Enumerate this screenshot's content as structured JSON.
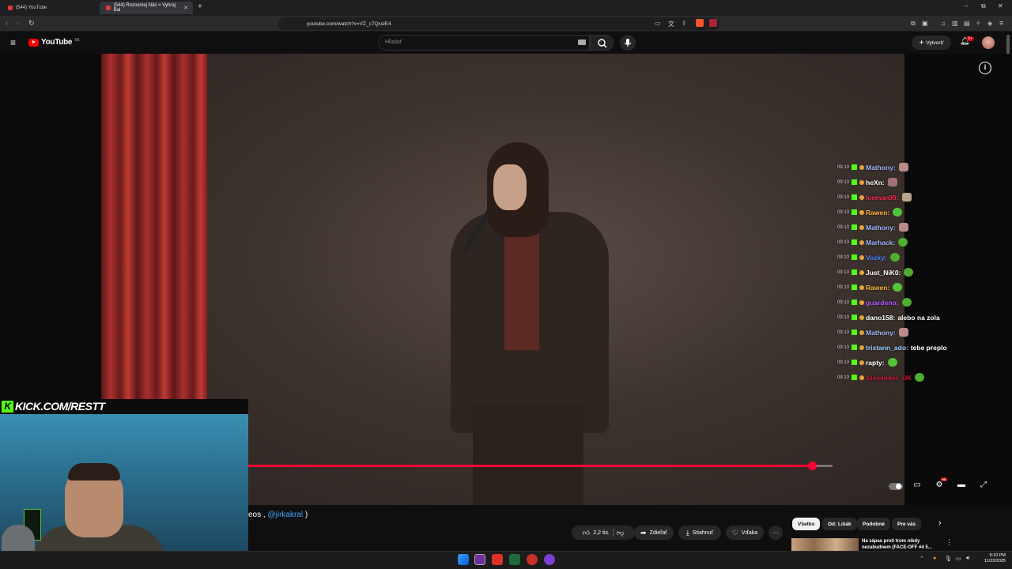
{
  "browser": {
    "tabs": [
      {
        "title": "(544) YouTube"
      },
      {
        "title": "(544) Rozosmej Nás = Vyhraj Bal"
      }
    ],
    "new_tab_symbol": "+",
    "url": "youtube.com/watch?v=VZ_c7QxsIE4",
    "window_controls": {
      "minimize": "–",
      "restore": "⧉",
      "close": "✕"
    },
    "toolbar_icons": [
      "back-icon",
      "forward-icon",
      "reload-icon",
      "bookmark-icon",
      "cast-icon",
      "translate-icon",
      "share-icon",
      "brave-shields-icon",
      "rewards-icon",
      "extensions-icon",
      "sidebar-icon",
      "wallet-icon",
      "vpn-icon",
      "menu-icon"
    ]
  },
  "youtube": {
    "logo_text": "YouTube",
    "logo_country": "SK",
    "search_placeholder": "Hľadať",
    "create_label": "Vytvoriť",
    "notifications_badge": "9+",
    "player": {
      "progress_fraction": 0.965,
      "info_symbol": "i"
    },
    "description_snippet": {
      "prefix": "eos , ",
      "mention": "@jirkakral",
      "suffix": " )"
    },
    "actions": {
      "like_count": "2,2 tis.",
      "share_label": "Zdieľať",
      "download_label": "Stiahnuť",
      "thanks_label": "Vďaka",
      "more_symbol": "···"
    },
    "chips": [
      "Všetko",
      "Od: Lišák",
      "Podobné",
      "Pre vás"
    ],
    "chips_next_symbol": "›",
    "recommendation": {
      "title": "Na zápas proti trom nikdy nezabudnem (FACE-OFF #4 5...",
      "more_symbol": "⋮"
    }
  },
  "overlay": {
    "kick_url": "KICK.COM/RESTT",
    "chat": [
      {
        "time": "09:10",
        "user": "Mathony:",
        "color": "#9fb8ff",
        "text": "",
        "emote": "#b98b8b"
      },
      {
        "time": "09:10",
        "user": "heXn:",
        "color": "#ffffff",
        "text": "",
        "emote": "#a56f7a"
      },
      {
        "time": "09:10",
        "user": "Iceman99:",
        "color": "#ff2a55",
        "text": "",
        "emote": "#b9a38a"
      },
      {
        "time": "09:10",
        "user": "Rawen:",
        "color": "#ffb43a",
        "text": "",
        "emote": "#53c43a"
      },
      {
        "time": "09:10",
        "user": "Mathony:",
        "color": "#9fb8ff",
        "text": "",
        "emote": "#b98b8b"
      },
      {
        "time": "09:10",
        "user": "Marhack:",
        "color": "#9fb8ff",
        "text": "",
        "emote": "#4fae2f"
      },
      {
        "time": "09:10",
        "user": "Vozky:",
        "color": "#4f8bff",
        "text": "",
        "emote": "#4fae2f"
      },
      {
        "time": "09:10",
        "user": "Just_NiK0:",
        "color": "#ffffff",
        "text": "",
        "emote": "#4fae2f"
      },
      {
        "time": "09:10",
        "user": "Rawen:",
        "color": "#ffb43a",
        "text": "",
        "emote": "#53c43a"
      },
      {
        "time": "09:10",
        "user": "guardeno:",
        "color": "#b35cff",
        "text": "",
        "emote": "#4fae2f"
      },
      {
        "time": "09:10",
        "user": "dano158:",
        "color": "#ffffff",
        "text": "alebo na zola",
        "emote": ""
      },
      {
        "time": "09:10",
        "user": "Mathony:",
        "color": "#9fb8ff",
        "text": "",
        "emote": "#b98b8b"
      },
      {
        "time": "09:10",
        "user": "tristann_ado:",
        "color": "#9fd0ff",
        "text": "tebe preplo",
        "emote": ""
      },
      {
        "time": "09:10",
        "user": "rapty:",
        "color": "#ffffff",
        "text": "",
        "emote": "#53c43a"
      },
      {
        "time": "09:10",
        "user": "Alexander_DK",
        "color": "#cc1a3a",
        "text": "",
        "emote": "#4fae2f"
      }
    ]
  },
  "taskbar": {
    "time": "9:10 PM",
    "date": "11/23/2025"
  }
}
